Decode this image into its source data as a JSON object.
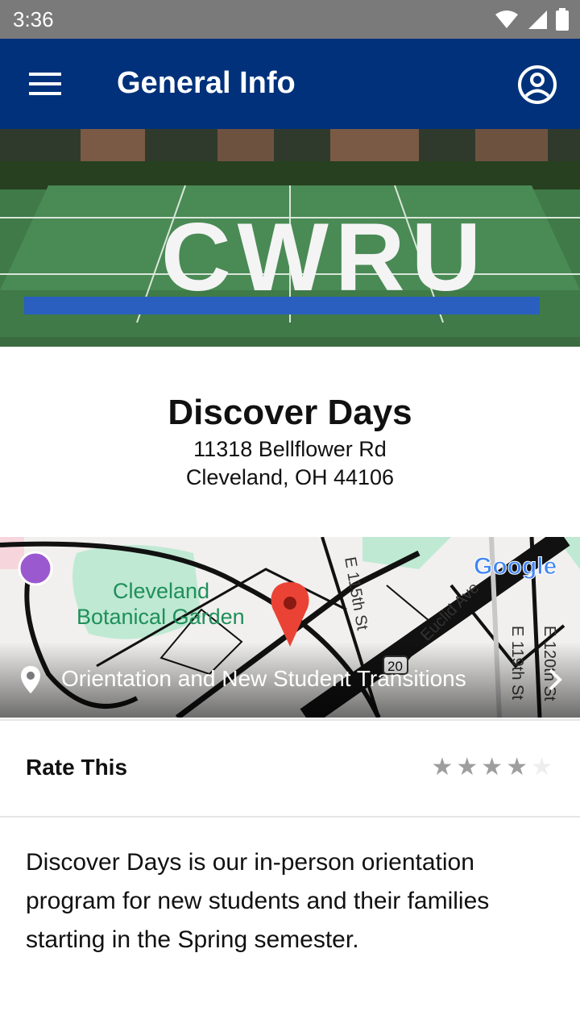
{
  "status": {
    "time": "3:36",
    "icons": [
      "wifi-icon",
      "signal-icon",
      "battery-icon"
    ]
  },
  "appbar": {
    "title": "General Info",
    "menu_icon": "hamburger-menu-icon",
    "account_icon": "account-circle-icon",
    "bg_color": "#00317a"
  },
  "hero": {
    "description": "CWRU"
  },
  "event": {
    "title": "Discover Days",
    "address_line1": "11318 Bellflower Rd",
    "address_line2": "Cleveland, OH 44106"
  },
  "map": {
    "location_label": "Orientation and New Student Transitions",
    "place_label_1": "Cleveland",
    "place_label_2": "Botanical Garden",
    "street_1": "E 115th St",
    "street_2": "Euclid Ave",
    "street_3": "E 119th St",
    "street_4": "E 120th St",
    "route_shield": "20",
    "google_logo": "Google"
  },
  "rating": {
    "label": "Rate This",
    "stars_filled": 4,
    "stars_total": 5,
    "filled_color": "#9e9e9e",
    "empty_color": "#eeeeee"
  },
  "description": "Discover Days is our in-person orientation program for new students and their families starting in the Spring semester."
}
